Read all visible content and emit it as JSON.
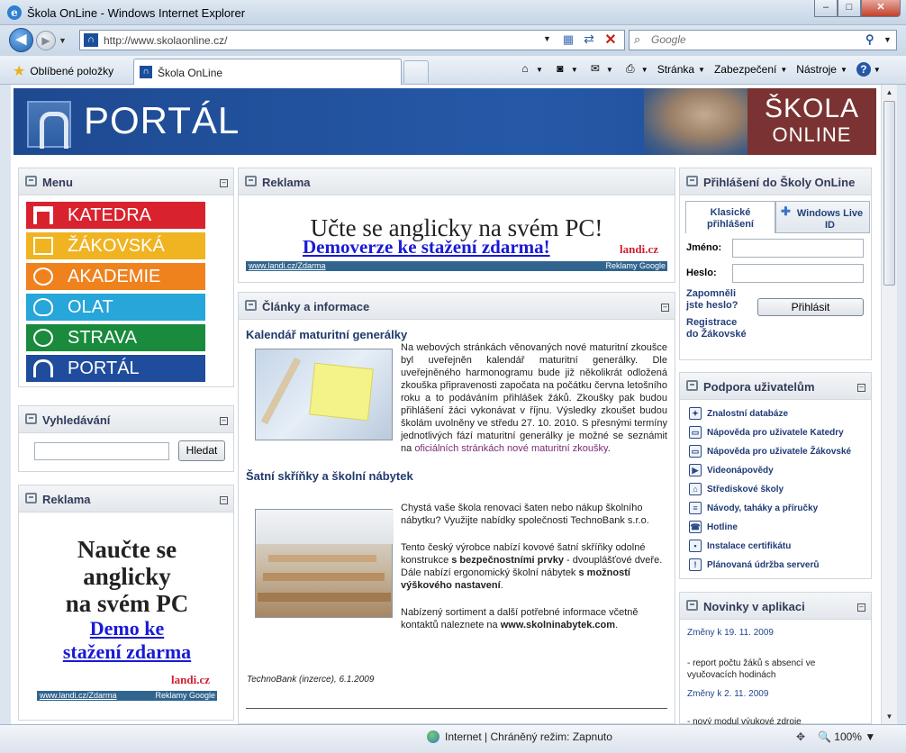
{
  "window": {
    "title": "Škola OnLine - Windows Internet Explorer",
    "app_icon": "ie-icon",
    "minimize": "–",
    "maximize": "□",
    "close": "✕"
  },
  "nav": {
    "address": "http://www.skolaonline.cz/",
    "search_placeholder": "Google"
  },
  "commandbar": {
    "favorites_label": "Oblíbené položky",
    "tab_label": "Škola OnLine",
    "page_menu": "Stránka",
    "security_menu": "Zabezpečení",
    "tools_menu": "Nástroje"
  },
  "banner": {
    "portal_text": "PORTÁL",
    "brand_line1": "ŠKOLA",
    "brand_line2": "ONLINE"
  },
  "menu_box": {
    "title": "Menu",
    "items": [
      {
        "label": "KATEDRA",
        "color": "#d8232f"
      },
      {
        "label": "ŽÁKOVSKÁ",
        "color": "#f0b322"
      },
      {
        "label": "AKADEMIE",
        "color": "#f0821e"
      },
      {
        "label": "OLAT",
        "color": "#26a6d9"
      },
      {
        "label": "STRAVA",
        "color": "#1a8a3c"
      },
      {
        "label": "PORTÁL",
        "color": "#1f4c9c"
      }
    ]
  },
  "search_box": {
    "title": "Vyhledávání",
    "button": "Hledat"
  },
  "ad_left": {
    "title": "Reklama",
    "line1": "Naučte se",
    "line2": "anglicky",
    "line3": "na svém PC",
    "link1": "Demo ke",
    "link2": "stažení zdarma",
    "brand": "landi.cz",
    "strip_left": "www.landi.cz/Zdarma",
    "strip_right": "Reklamy Google"
  },
  "ad_top": {
    "title": "Reklama",
    "headline": "Učte se anglicky na svém PC!",
    "link": "Demoverze ke stažení zdarma!",
    "brand": "landi.cz",
    "strip_left": "www.landi.cz/Zdarma",
    "strip_right": "Reklamy Google"
  },
  "articles_box": {
    "title": "Články a informace",
    "a1_title": "Kalendář maturitní generálky",
    "a1_text": "Na webových stránkách věnovaných nové maturitní zkoušce byl uveřejněn kalendář maturitní generálky. Dle uveřejněného harmonogramu bude již několikrát odložená zkouška připravenosti započata na počátku června letošního roku a to podáváním přihlášek žáků. Zkoušky pak budou přihlášení žáci vykonávat v říjnu. Výsledky zkoušet budou školám uvolněny ve středu 27. 10. 2010. S přesnými termíny jednotlivých fází maturitní generálky je možné se seznámit na",
    "a1_link": "oficiálních stránkách nové maturitní zkoušky",
    "a1_end": ".",
    "a2_title": "Šatní skříňky a školní nábytek",
    "a2_p1": "Chystá vaše škola renovaci šaten nebo nákup školního nábytku? Využijte nabídky společnosti TechnoBank s.r.o.",
    "a2_p2a": "Tento český výrobce nabízí kovové šatní skříňky odolné konstrukce ",
    "a2_p2b": "s bezpečnostními prvky",
    "a2_p2c": " - dvouplášťové dveře. Dále nabízí ergonomický školní nábytek ",
    "a2_p2d": "s možností výškového nastavení",
    "a2_p2e": ".",
    "a2_p3a": "Nabízený sortiment a další potřebné informace včetně kontaktů naleznete na ",
    "a2_p3b": "www.skolninabytek.com",
    "a2_p3c": ".",
    "a2_footer": "TechnoBank (inzerce), 6.1.2009"
  },
  "login_box": {
    "title": "Přihlášení do Školy OnLine",
    "tab1": "Klasické přihlášení",
    "tab2": "Windows Live ID",
    "name_label": "Jméno:",
    "password_label": "Heslo:",
    "forgot_link": "Zapomněli jste heslo?",
    "register_link": "Registrace do Žákovské",
    "login_button": "Přihlásit"
  },
  "support_box": {
    "title": "Podpora uživatelům",
    "items": [
      "Znalostní databáze",
      "Nápověda pro uživatele Katedry",
      "Nápověda pro uživatele Žákovské",
      "Videonápovědy",
      "Střediskové školy",
      "Návody, taháky a příručky",
      "Hotline",
      "Instalace certifikátu",
      "Plánovaná údržba serverů"
    ]
  },
  "news_box": {
    "title": "Novinky v aplikaci",
    "d1": "Změny k 19. 11. 2009",
    "t1": "- report počtu žáků s absencí ve vyučovacích hodinách",
    "d2": "Změny k 2. 11. 2009",
    "t2": "- nový modul výukové zdroje"
  },
  "status": {
    "zone": "Internet | Chráněný režim: Zapnuto",
    "zoom": "100%"
  }
}
